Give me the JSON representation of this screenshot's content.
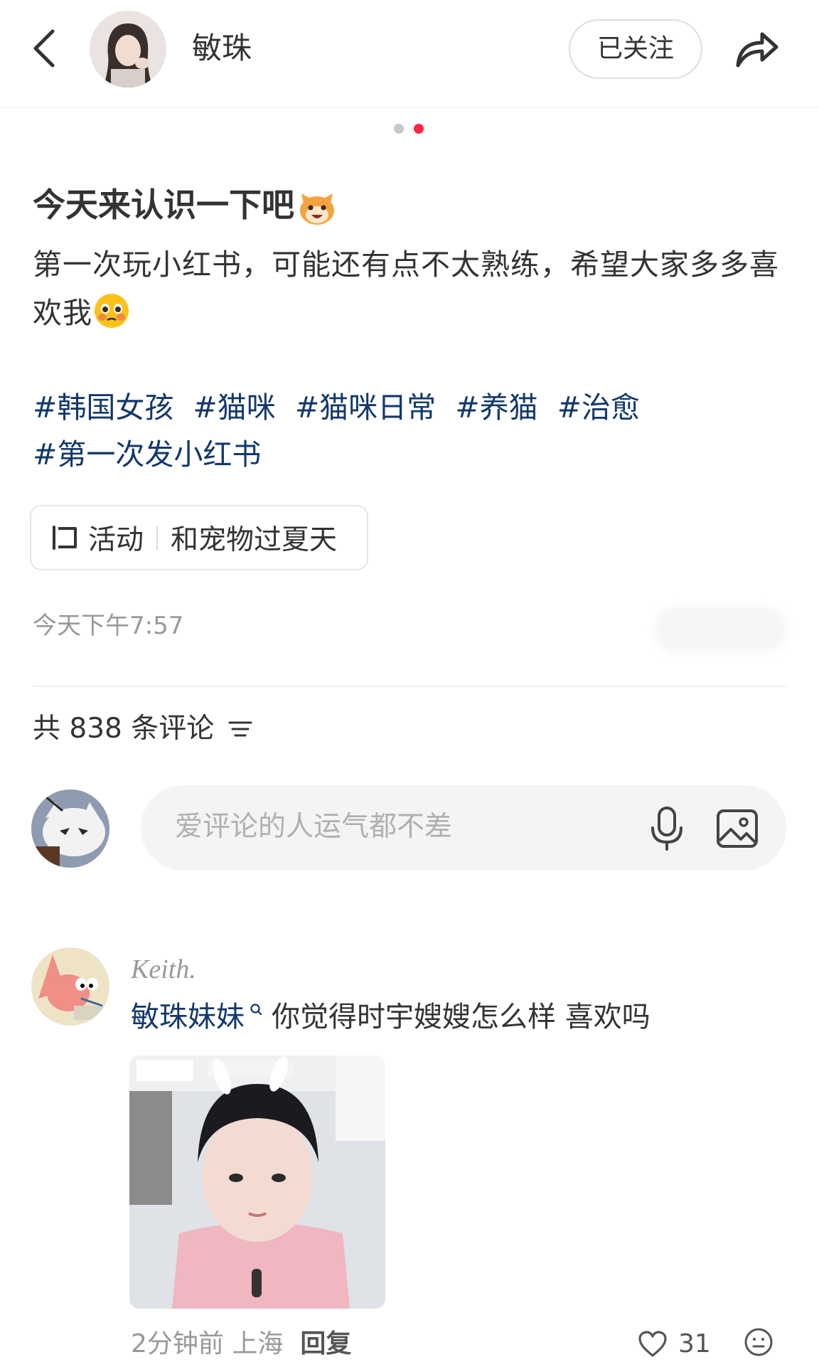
{
  "header": {
    "author_name": "敏珠",
    "follow_label": "已关注"
  },
  "carousel": {
    "count": 2,
    "active_index": 1
  },
  "post": {
    "title": "今天来认识一下吧",
    "body_line": "第一次玩小红书，可能还有点不太熟练，希望大家多多喜欢我",
    "tags": [
      "#韩国女孩",
      "#猫咪",
      "#猫咪日常",
      "#养猫",
      "#治愈",
      "#第一次发小红书"
    ],
    "activity_label": "活动",
    "activity_name": "和宠物过夏天",
    "time": "今天下午7:57"
  },
  "comments_section": {
    "count_text": "共 838 条评论",
    "input_placeholder": "爱评论的人运气都不差"
  },
  "comment": {
    "user": "Keith.",
    "mention": "敏珠妹妹",
    "text": "你觉得时宇嫂嫂怎么样 喜欢吗",
    "time_location": "2分钟前 上海",
    "reply_label": "回复",
    "likes": "31"
  },
  "colors": {
    "accent_red": "#ff2442",
    "tag_blue": "#13386c",
    "muted_gray": "#999999"
  },
  "icons": [
    "back-icon",
    "share-icon",
    "activity-icon",
    "sort-icon",
    "microphone-icon",
    "image-icon",
    "search-icon",
    "heart-icon",
    "emoji-icon",
    "cat-emoji-icon",
    "pleading-emoji-icon"
  ]
}
